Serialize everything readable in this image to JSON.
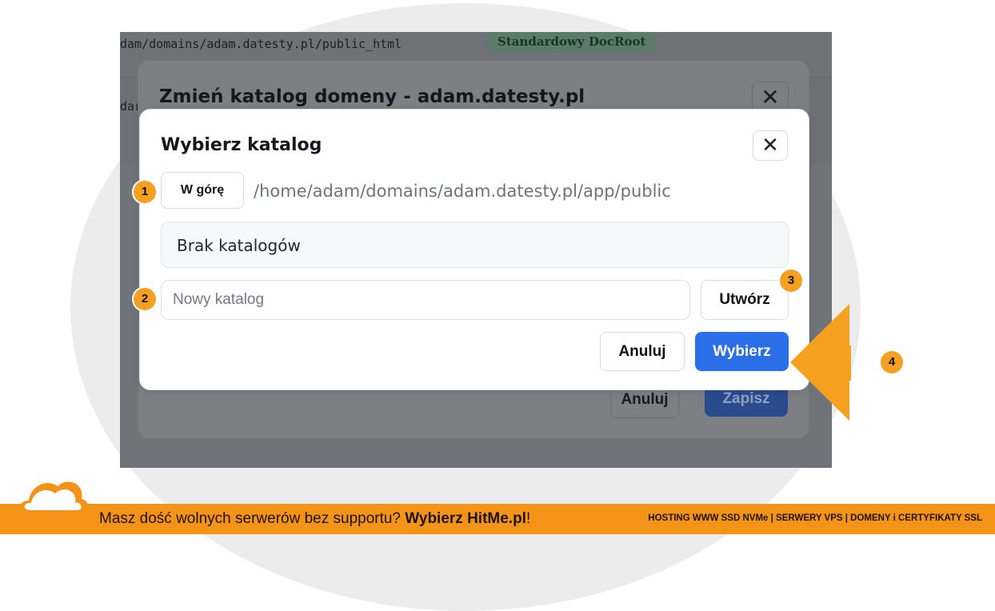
{
  "background_page": {
    "docroot_path": "dam/domains/adam.datesty.pl/public_html",
    "docroot_badge": "Standardowy DocRoot",
    "row2_text": "dar"
  },
  "outer_modal": {
    "title": "Zmień katalog domeny - adam.datesty.pl",
    "close_glyph": "✕",
    "cancel_label": "Anuluj",
    "save_label": "Zapisz"
  },
  "dialog": {
    "title": "Wybierz katalog",
    "close_glyph": "✕",
    "up_label": "W górę",
    "current_path": "/home/adam/domains/adam.datesty.pl/app/public",
    "empty_message": "Brak katalogów",
    "new_folder_placeholder": "Nowy katalog",
    "create_label": "Utwórz",
    "cancel_label": "Anuluj",
    "select_label": "Wybierz"
  },
  "callouts": [
    "1",
    "2",
    "3",
    "4"
  ],
  "banner": {
    "text_prefix": "Masz dość wolnych serwerów bez supportu? ",
    "text_brand": "Wybierz HitMe.pl",
    "text_suffix": "!",
    "services": "HOSTING WWW SSD NVMe | SERWERY VPS | DOMENY i CERTYFIKATY SSL"
  },
  "colors": {
    "accent_orange": "#f5a020",
    "primary_blue": "#2a6ee8",
    "banner_orange": "#f39419"
  },
  "icons": [
    "close-icon",
    "arrow-pointer-icon",
    "cloud-logo-icon"
  ]
}
